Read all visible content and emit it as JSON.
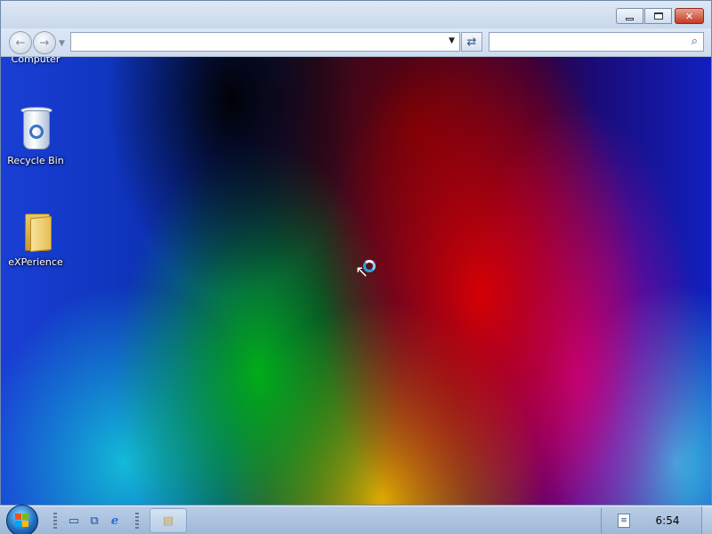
{
  "window": {
    "address_value": "",
    "address_placeholder": "",
    "search_value": "",
    "search_placeholder": ""
  },
  "desktop": {
    "icons": [
      {
        "label": "Computer"
      },
      {
        "label": "Recycle Bin"
      },
      {
        "label": "eXPerience"
      }
    ]
  },
  "taskbar": {
    "clock": "6:54"
  },
  "icons": {
    "start": "windows-flag-icon",
    "quick_launch": [
      "show-desktop-icon",
      "switch-windows-icon",
      "internet-explorer-icon"
    ],
    "tray": "document-icon"
  },
  "colors": {
    "taskbar": "#a9c0de",
    "window_chrome": "#d3e0f0",
    "close_button": "#c43a22"
  }
}
